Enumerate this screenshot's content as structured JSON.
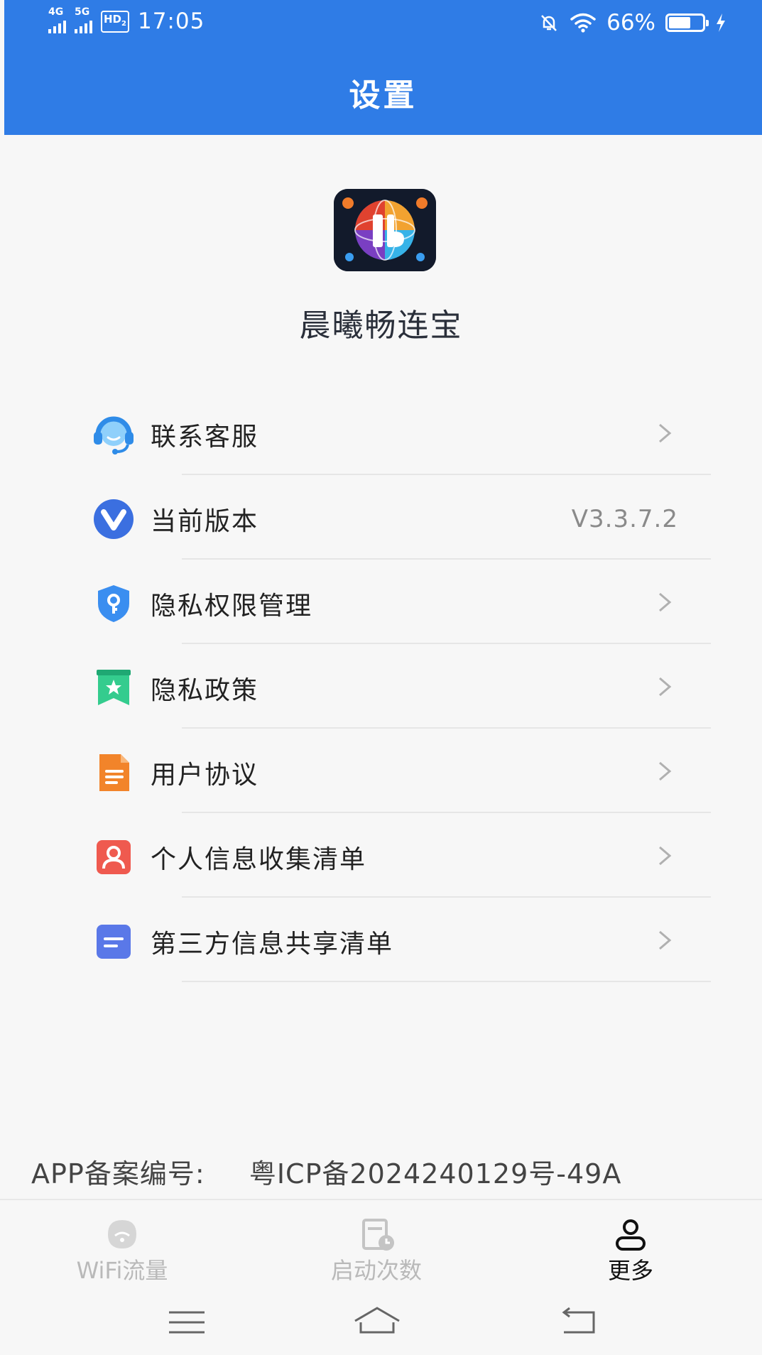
{
  "status_bar": {
    "sim1_network": "4G",
    "sim2_network": "5G",
    "hd_badge": "HD",
    "hd_badge_sub": "2",
    "time": "17:05",
    "battery_percent": "66%",
    "battery_level": 0.66
  },
  "header": {
    "title": "设置"
  },
  "app": {
    "name": "晨曦畅连宝"
  },
  "menu": {
    "items": [
      {
        "label": "联系客服",
        "icon": "headset-icon",
        "color": "#3aa0f0"
      },
      {
        "label": "当前版本",
        "icon": "version-v-icon",
        "color": "#3b6fe0",
        "value": "V3.3.7.2"
      },
      {
        "label": "隐私权限管理",
        "icon": "shield-key-icon",
        "color": "#3a8ef0"
      },
      {
        "label": "隐私政策",
        "icon": "bookmark-star-icon",
        "color": "#2fc58a"
      },
      {
        "label": "用户协议",
        "icon": "document-icon",
        "color": "#f2842a"
      },
      {
        "label": "个人信息收集清单",
        "icon": "person-card-icon",
        "color": "#ef5a4f"
      },
      {
        "label": "第三方信息共享清单",
        "icon": "list-card-icon",
        "color": "#5a78e8"
      }
    ]
  },
  "footer": {
    "icp_label": "APP备案编号:",
    "icp_number": "粤ICP备2024240129号-49A"
  },
  "tabbar": {
    "tabs": [
      {
        "label": "WiFi流量",
        "icon": "wifi-traffic-icon",
        "active": false
      },
      {
        "label": "启动次数",
        "icon": "launch-count-icon",
        "active": false
      },
      {
        "label": "更多",
        "icon": "user-more-icon",
        "active": true
      }
    ]
  },
  "colors": {
    "header_bg": "#2f7ce6",
    "background": "#f7f7f7",
    "inactive_tab": "#b9b9b9",
    "active_tab": "#111111"
  }
}
